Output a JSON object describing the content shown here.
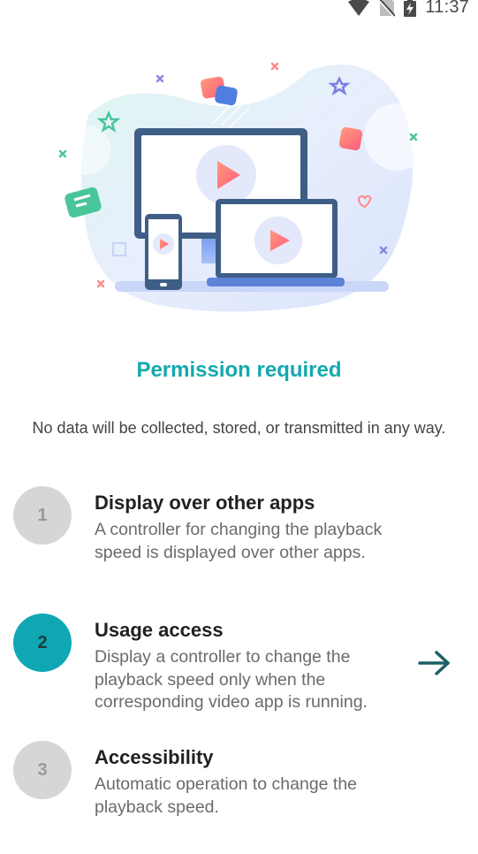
{
  "status_bar": {
    "time": "11:37",
    "icons": [
      "wifi-icon",
      "no-sim-icon",
      "battery-charging-icon"
    ]
  },
  "hero": {
    "icon": "devices-video-illustration"
  },
  "title": "Permission required",
  "subtitle": "No data will be collected, stored, or transmitted in any way.",
  "steps": [
    {
      "number": "1",
      "title": "Display over other apps",
      "description": "A controller for changing the playback speed is displayed over other apps.",
      "state": "inactive"
    },
    {
      "number": "2",
      "title": "Usage access",
      "description": "Display a controller to change the playback speed only when the corresponding video app is running.",
      "state": "active"
    },
    {
      "number": "3",
      "title": "Accessibility",
      "description": "Automatic operation to change the playback speed.",
      "state": "inactive"
    }
  ],
  "colors": {
    "accent": "#13a9ad",
    "active_step": "#0fa7b4",
    "inactive_step": "#d6d6d6",
    "arrow": "#1d5f66"
  },
  "next_icon": "arrow-right-icon"
}
